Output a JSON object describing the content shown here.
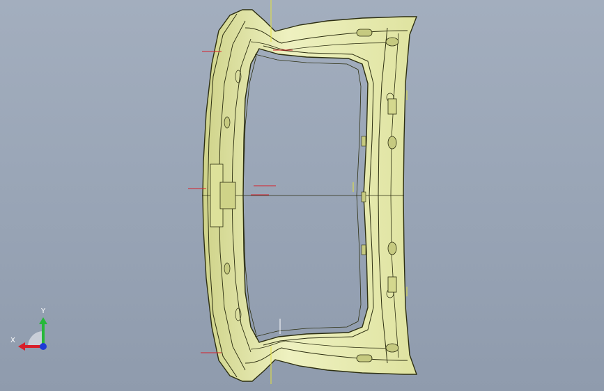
{
  "viewport": {
    "background_top": "#a3aebe",
    "background_bottom": "#8f9bad"
  },
  "model": {
    "part": "tailgate-inner-panel",
    "fill_color": "#e9edb0",
    "edge_color": "#2c2e10",
    "construction_line_colors": {
      "x": "#d8202a",
      "y": "#e6e23a"
    }
  },
  "triad": {
    "y_label": "Y",
    "x_label": "X",
    "colors": {
      "x": "#d81e2a",
      "y": "#26b83a",
      "z": "#1f3ad6"
    }
  }
}
